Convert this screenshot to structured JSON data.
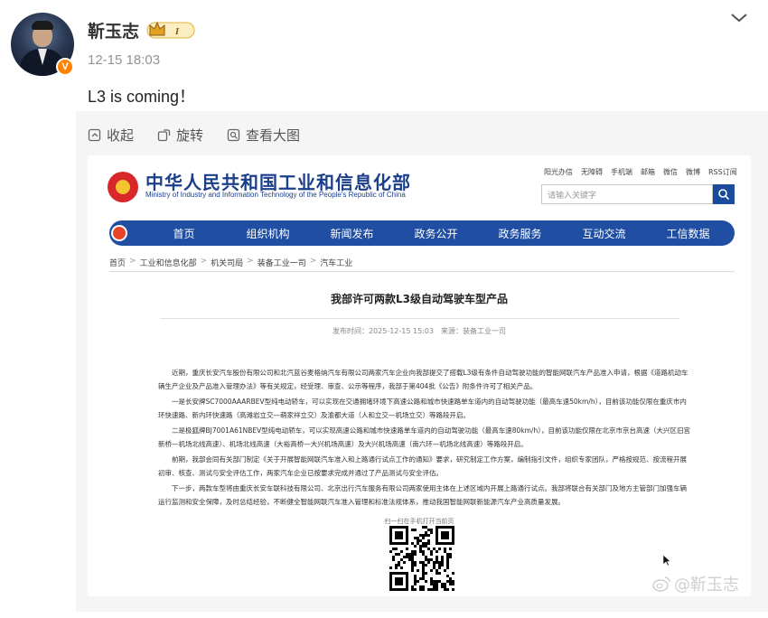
{
  "post": {
    "author": "靳玉志",
    "rank_label": "I",
    "timestamp": "12-15 18:03",
    "text": "L3 is coming！"
  },
  "toolbar": {
    "collapse_label": "收起",
    "rotate_label": "旋转",
    "view_large_label": "查看大图"
  },
  "watermark": "@靳玉志",
  "screenshot": {
    "ministry_cn": "中华人民共和国工业和信息化部",
    "ministry_en": "Ministry of Industry and Information Technology of the People's Republic of China",
    "top_links": [
      "阳光办信",
      "无障碍",
      "手机端",
      "邮箱",
      "微信",
      "微博",
      "RSS订阅"
    ],
    "search_placeholder": "请输入关键字",
    "nav": [
      "首页",
      "组织机构",
      "新闻发布",
      "政务公开",
      "政务服务",
      "互动交流",
      "工信数据"
    ],
    "breadcrumbs": [
      "首页",
      "工业和信息化部",
      "机关司局",
      "装备工业一司",
      "汽车工业"
    ],
    "article_title": "我部许可两款L3级自动驾驶车型产品",
    "article_meta": "发布时间：2025-12-15 15:03　来源：装备工业一司",
    "paragraphs": [
      "近期，重庆长安汽车股份有限公司和北汽蓝谷麦格纳汽车有限公司两家汽车企业向我部提交了搭载L3级有条件自动驾驶功能的智能网联汽车产品准入申请，根据《道路机动车辆生产企业及产品准入管理办法》等有关规定，经受理、审查、公示等程序，我部于第404批《公告》附条件许可了相关产品。",
      "一是长安牌SC7000AAARBEV型纯电动轿车，可以实现在交通拥堵环境下高速公路和城市快速路单车道内的自动驾驶功能（最高车速50km/h），目前该功能仅限在重庆市内环快速路、新内环快速路（高滩岩立交—萌家祥立交）及渝都大道（人和立交—机场立交）等路段开启。",
      "二是极狐牌BJ7001A61NBEV型纯电动轿车，可以实现高速公路和城市快速路单车道内的自动驾驶功能（最高车速80km/h），目前该功能仅限在北京市京台高速（大兴区旧宫新桥—机场北线高速）、机场北线高速（大裕高桥—大兴机场高速）及大兴机场高速（南六环—机场北线高速）等路段开启。",
      "前期，我部会同有关部门制定《关于开展智能网联汽车准入和上路通行试点工作的通知》要求，研究制定工作方案，编制指引文件，组织专家团队，严格按规范、按流程开展初审、核查、测试与安全评估工作，两家汽车企业已按要求完成并通过了产品测试与安全评估。",
      "下一步，两款车型将由重庆长安车联科技有限公司、北京出行汽车服务有限公司两家使用主体在上述区域内开展上路通行试点。我部将联合有关部门及地方主管部门加强车辆运行监测和安全保障，及时总结经验，不断健全智能网联汽车准入管理和标准法规体系，推动我国智能网联新能源汽车产业高质量发展。"
    ],
    "qr_label": "扫一扫在手机打开当前页"
  },
  "colors": {
    "nav_blue": "#1f4ea3",
    "ministry_blue": "#1b3f8b",
    "verified_orange": "#ff8200",
    "emblem_red": "#d9282b"
  }
}
